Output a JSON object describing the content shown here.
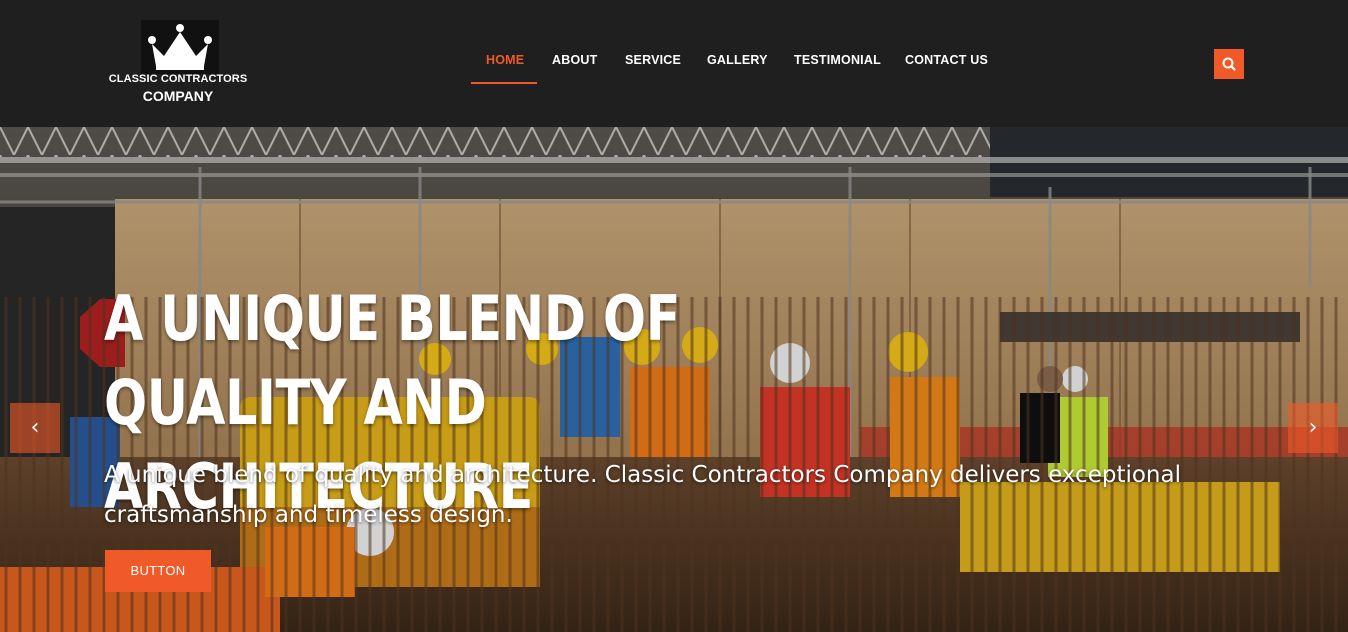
{
  "brand": {
    "line1": "CLASSIC CONTRACTORS",
    "line2": "COMPANY",
    "logo_icon": "crown-icon"
  },
  "nav": {
    "items": [
      {
        "label": "HOME",
        "active": true
      },
      {
        "label": "ABOUT",
        "active": false
      },
      {
        "label": "SERVICE",
        "active": false
      },
      {
        "label": "GALLERY",
        "active": false
      },
      {
        "label": "TESTIMONIAL",
        "active": false
      },
      {
        "label": "CONTACT US",
        "active": false
      }
    ],
    "search_icon": "search-icon"
  },
  "hero": {
    "title": "A UNIQUE BLEND OF QUALITY AND ARCHITECTURE",
    "subtitle": "A unique blend of quality and architecture. Classic Contractors Company delivers exceptional craftsmanship and timeless design.",
    "button_label": "BUTTON",
    "prev_icon": "‹",
    "next_icon": "›"
  },
  "colors": {
    "accent": "#f05a28",
    "header_bg": "#1f1f1f",
    "text": "#ffffff"
  }
}
